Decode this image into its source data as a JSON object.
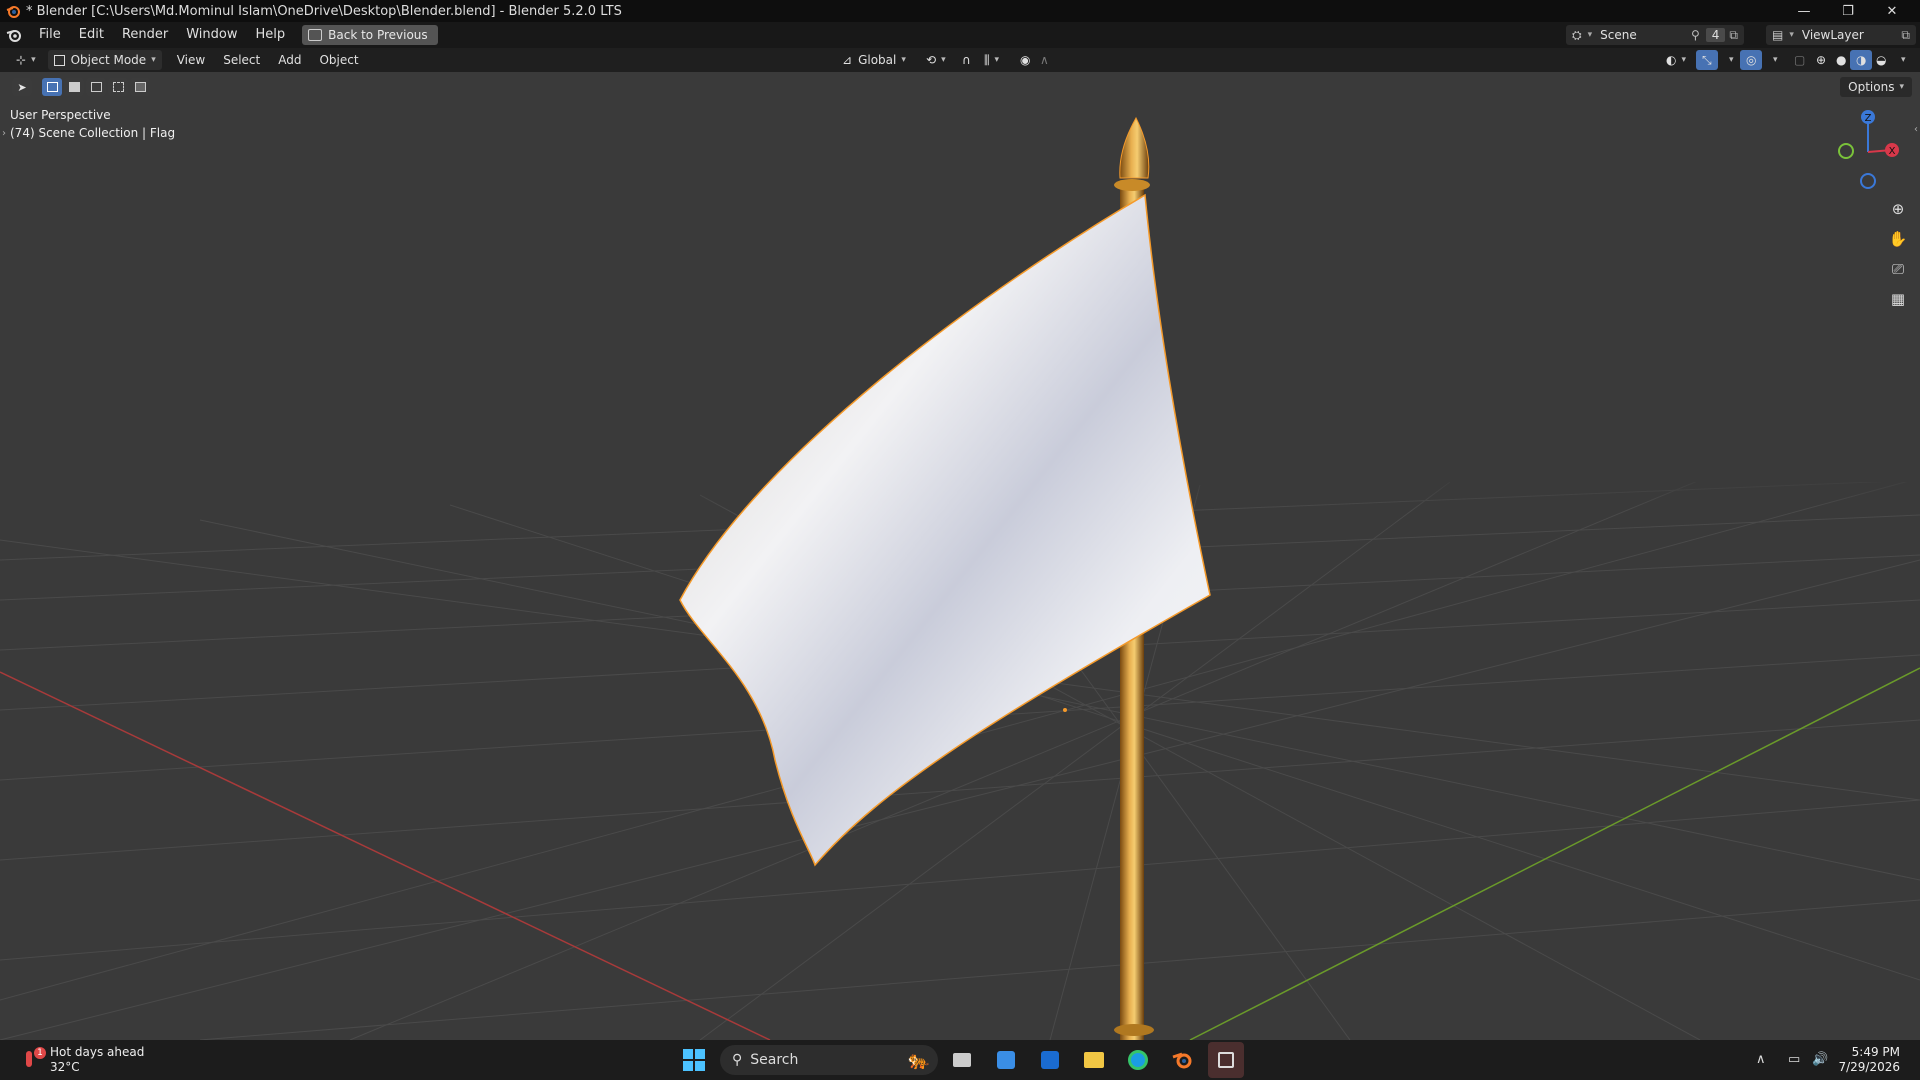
{
  "window": {
    "title": "* Blender [C:\\Users\\Md.Mominul Islam\\OneDrive\\Desktop\\Blender.blend] - Blender 5.2.0 LTS",
    "controls": [
      "—",
      "❐",
      "✕"
    ]
  },
  "menubar": {
    "items": [
      "File",
      "Edit",
      "Render",
      "Window",
      "Help"
    ],
    "back_button": "Back to Previous",
    "scene_label": "Scene",
    "scene_users": "4",
    "view_layer": "ViewLayer"
  },
  "viewport_header": {
    "mode": "Object Mode",
    "menus": [
      "View",
      "Select",
      "Add",
      "Object"
    ],
    "transform_orientation": "Global",
    "options_label": "Options"
  },
  "viewport": {
    "perspective_label": "User Perspective",
    "collection_label": "(74) Scene Collection | Flag",
    "gizmo": {
      "z": "Z",
      "x": "X"
    },
    "colors": {
      "background": "#3a3a3a",
      "grid": "#4a4a4a",
      "x_axis": "#a83a3a",
      "y_axis": "#6a9a2a",
      "flag": "#e8e8ec",
      "pole": "#c88a28",
      "selection": "#f59a2a"
    }
  },
  "taskbar": {
    "weather_title": "Hot days ahead",
    "weather_temp": "32°C",
    "weather_badge": "1",
    "search_label": "Search",
    "time": "5:49 PM",
    "date": "7/29/2026"
  }
}
